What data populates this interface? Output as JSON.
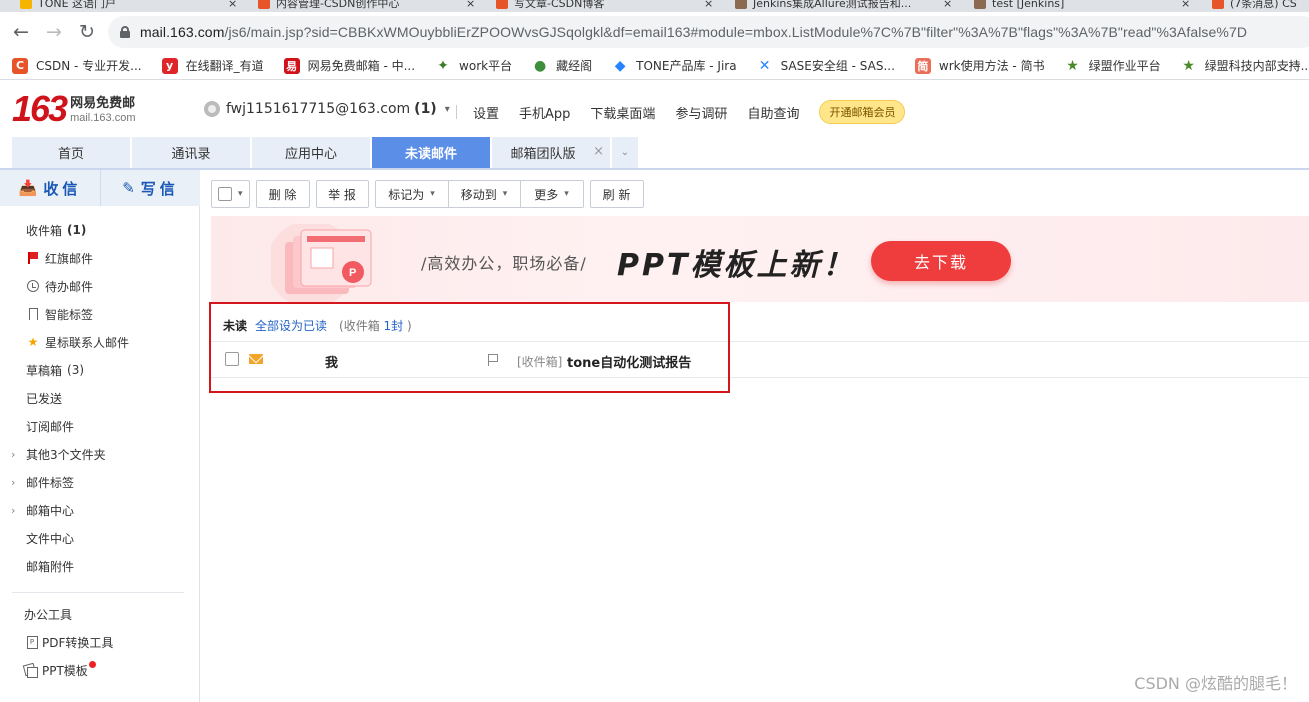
{
  "browser": {
    "tabs": [
      {
        "label": "TONE 这语门户",
        "fav": "#f4b400"
      },
      {
        "label": "内容管理-CSDN创作中心",
        "fav": "#e8542a"
      },
      {
        "label": "写文章-CSDN博客",
        "fav": "#e8542a"
      },
      {
        "label": "Jenkins集成Allure测试报告和...",
        "fav": "#8c6a4f"
      },
      {
        "label": "test [Jenkins]",
        "fav": "#8c6a4f"
      },
      {
        "label": "(7条消息) CS",
        "fav": "#e8542a"
      }
    ],
    "tab_close": "×",
    "url_host": "mail.163.com",
    "url_rest": "/js6/main.jsp?sid=CBBKxWMOuybbliErZPOOWvsGJSqolgkl&df=email163#module=mbox.ListModule%7C%7B\"filter\"%3A%7B\"flags\"%3A%7B\"read\"%3Afalse%7D",
    "bookmarks": [
      {
        "label": "CSDN - 专业开发...",
        "icon": "csdn-icon",
        "glyph": "C",
        "color": "#e8542a"
      },
      {
        "label": "在线翻译_有道",
        "icon": "youdao-icon",
        "glyph": "y",
        "color": "#e0252a"
      },
      {
        "label": "网易免费邮箱 - 中...",
        "icon": "netease-icon",
        "glyph": "易",
        "color": "#d0121b"
      },
      {
        "label": "work平台",
        "icon": "leaf-icon",
        "glyph": "✦",
        "color": "#3c7a2a"
      },
      {
        "label": "藏经阁",
        "icon": "chrome-icon",
        "glyph": "●",
        "color": "#3d8f3d"
      },
      {
        "label": "TONE产品库 - Jira",
        "icon": "jira-icon",
        "glyph": "◆",
        "color": "#2684ff"
      },
      {
        "label": "SASE安全组 - SAS...",
        "icon": "confluence-icon",
        "glyph": "✕",
        "color": "#2684ff"
      },
      {
        "label": "wrk使用方法 - 简书",
        "icon": "jianshu-icon",
        "glyph": "简",
        "color": "#ea6f5a"
      },
      {
        "label": "绿盟作业平台",
        "icon": "star-green-icon",
        "glyph": "★",
        "color": "#4a8a2a"
      },
      {
        "label": "绿盟科技内部支持...",
        "icon": "star-green-icon",
        "glyph": "★",
        "color": "#4a8a2a"
      }
    ]
  },
  "header": {
    "logo_num": "163",
    "logo_cn": "网易免费邮",
    "logo_en": "mail.163.com",
    "account": "fwj1151617715@163.com",
    "account_count": "(1)",
    "nav": [
      "设置",
      "手机App",
      "下载桌面端",
      "参与调研",
      "自助查询"
    ],
    "vip": "开通邮箱会员"
  },
  "module_tabs": [
    "首页",
    "通讯录",
    "应用中心",
    "未读邮件",
    "邮箱团队版"
  ],
  "module_close": "×",
  "sidebar": {
    "receive": "收信",
    "compose": "写信",
    "folders": [
      {
        "label": "收件箱",
        "count": "(1)",
        "icon": "",
        "bold": true
      },
      {
        "label": "红旗邮件",
        "icon": "flag"
      },
      {
        "label": "待办邮件",
        "icon": "clock"
      },
      {
        "label": "智能标签",
        "icon": "bookmark"
      },
      {
        "label": "星标联系人邮件",
        "icon": "star"
      },
      {
        "label": "草稿箱",
        "count": "(3)",
        "icon": ""
      },
      {
        "label": "已发送",
        "icon": ""
      },
      {
        "label": "订阅邮件",
        "icon": ""
      },
      {
        "label": "其他3个文件夹",
        "icon": "",
        "arrow": true
      },
      {
        "label": "邮件标签",
        "icon": "",
        "arrow": true
      },
      {
        "label": "邮箱中心",
        "icon": "",
        "arrow": true
      },
      {
        "label": "文件中心",
        "icon": ""
      },
      {
        "label": "邮箱附件",
        "icon": ""
      }
    ],
    "tools_title": "办公工具",
    "tools": [
      "PDF转换工具",
      "PPT模板"
    ]
  },
  "toolbar": {
    "delete": "删 除",
    "report": "举 报",
    "mark": "标记为",
    "move": "移动到",
    "more": "更多",
    "refresh": "刷 新"
  },
  "banner": {
    "slogan": "/高效办公，职场必备/",
    "title": "PPT模板上新！",
    "button": "去下载"
  },
  "list": {
    "title": "未读",
    "mark_all": "全部设为已读",
    "meta_prefix": "(收件箱 ",
    "meta_count": "1封",
    "meta_suffix": " )",
    "rows": [
      {
        "sender": "我",
        "folder": "[收件箱]",
        "subject": "tone自动化测试报告"
      }
    ]
  },
  "watermark": "CSDN @炫酷的腿毛！"
}
